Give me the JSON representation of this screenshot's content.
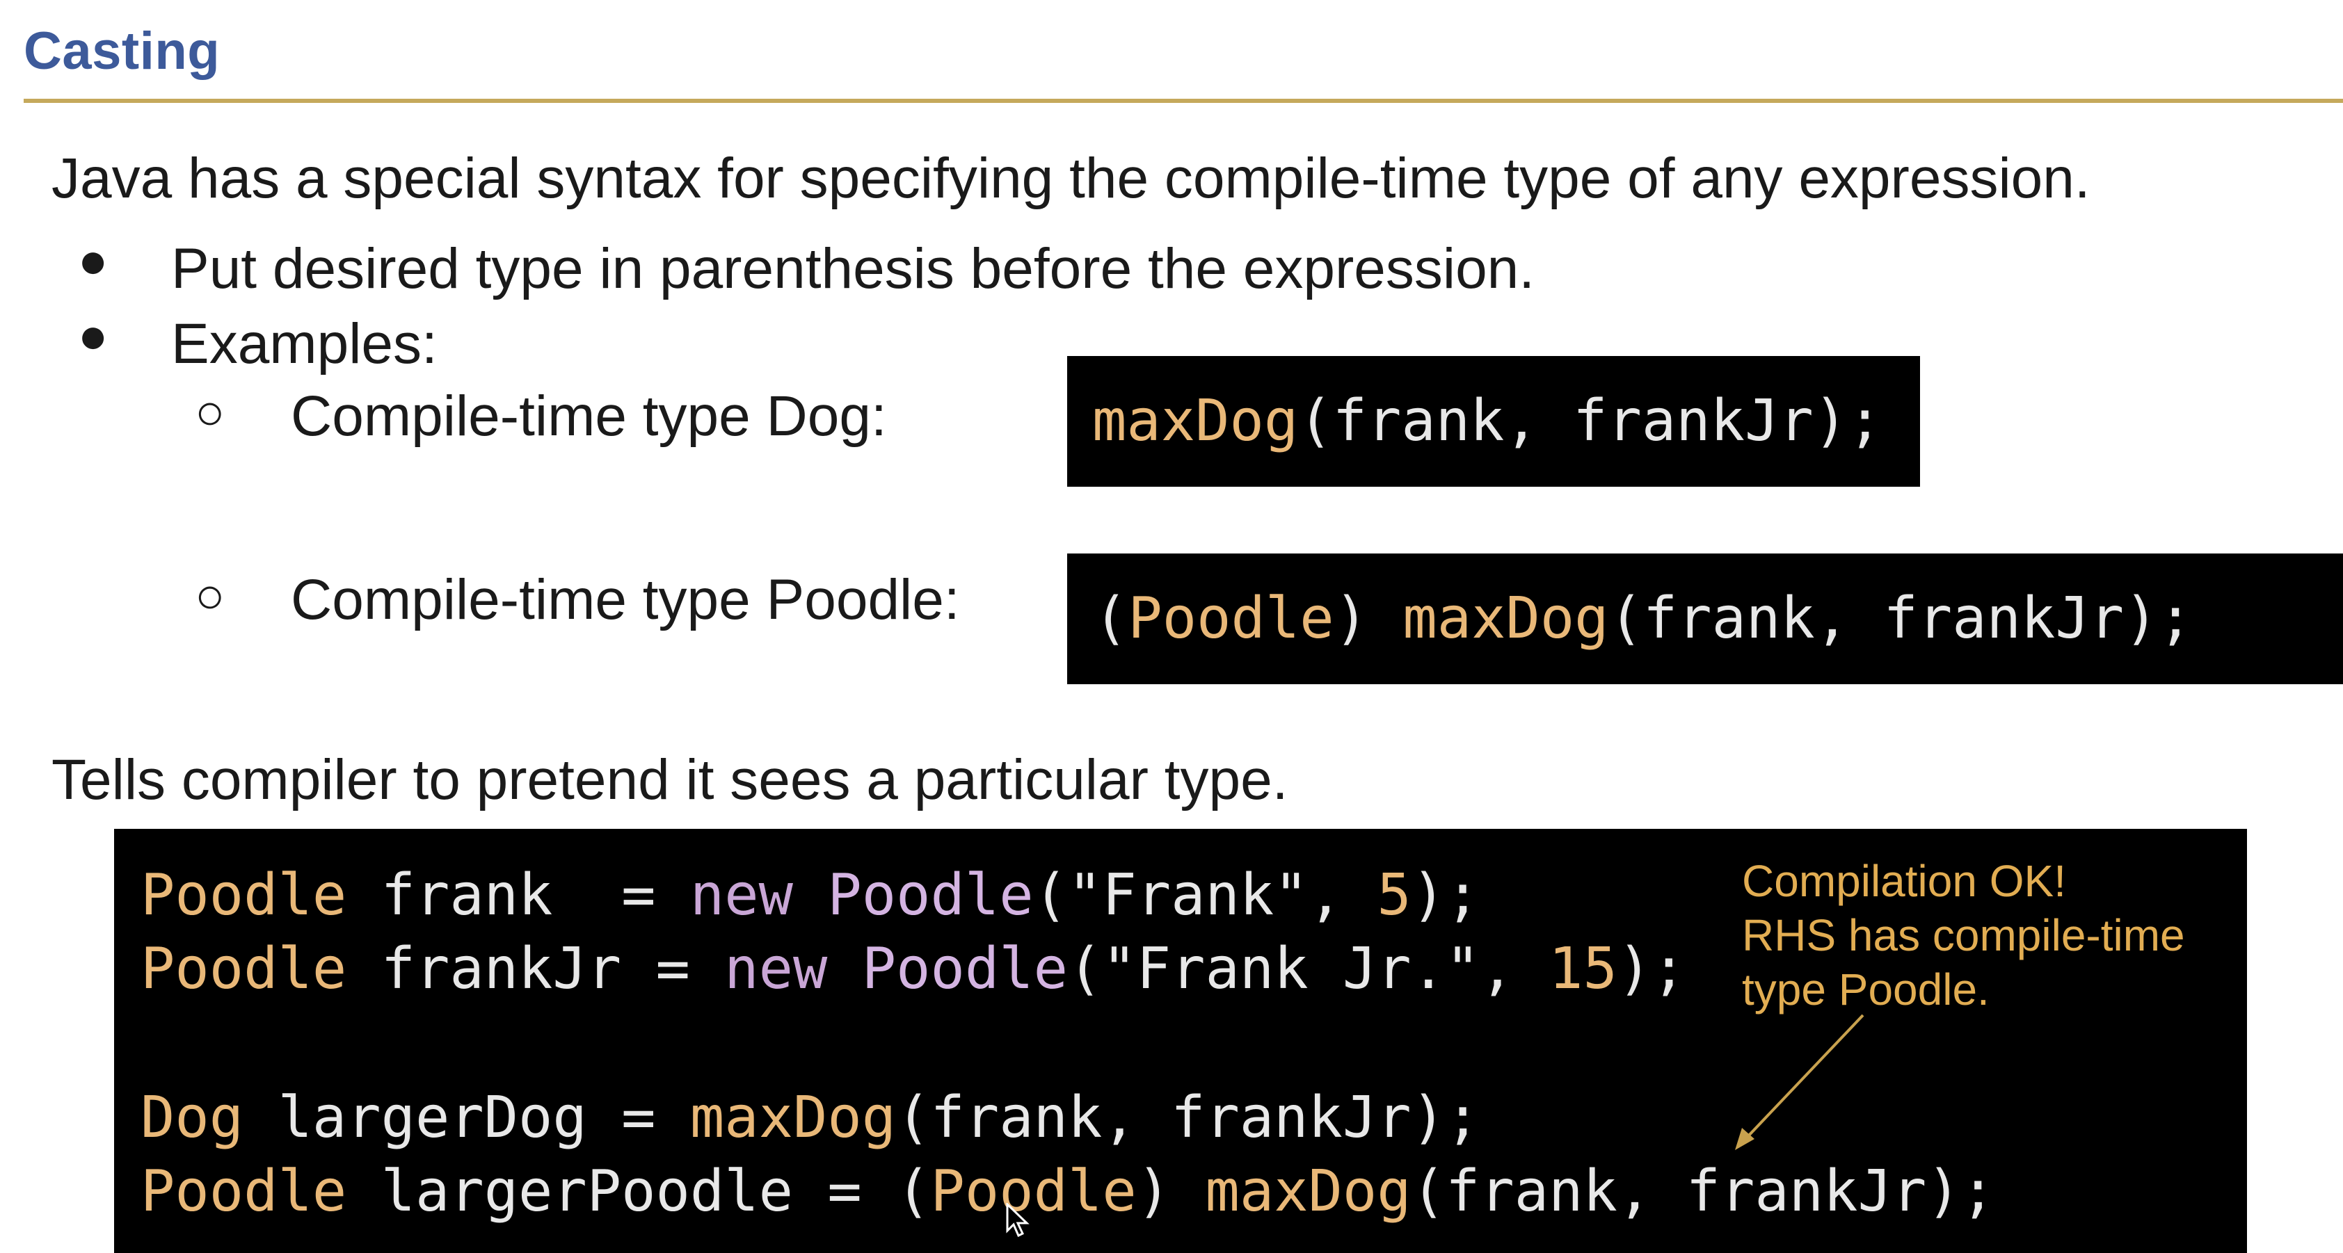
{
  "slide": {
    "title": "Casting",
    "intro": "Java has a special syntax for specifying the compile-time type of any expression.",
    "bullets": [
      "Put desired type in parenthesis before the expression.",
      "Examples:"
    ],
    "sub_bullets": [
      "Compile-time type Dog:",
      "Compile-time type Poodle:"
    ],
    "tells": "Tells compiler to pretend it sees a particular type."
  },
  "examples": {
    "dog": {
      "fn": "maxDog",
      "rest": "(frank, frankJr);"
    },
    "poodle": {
      "open": "(",
      "type": "Poodle",
      "close": ") ",
      "fn": "maxDog",
      "rest": "(frank, frankJr);"
    }
  },
  "code": {
    "line1": {
      "type": "Poodle",
      "var": " frank  = ",
      "new": "new",
      "sp": " ",
      "cls": "Poodle",
      "open": "(",
      "str": "\"Frank\"",
      "sep": ", ",
      "num": "5",
      "end": ");"
    },
    "line2": {
      "type": "Poodle",
      "var": " frankJr = ",
      "new": "new",
      "sp": " ",
      "cls": "Poodle",
      "open": "(",
      "str": "\"Frank Jr.\"",
      "sep": ", ",
      "num": "15",
      "end": ");"
    },
    "line3": {
      "type": "Dog",
      "var": " largerDog = ",
      "fn": "maxDog",
      "rest": "(frank, frankJr);"
    },
    "line4": {
      "type": "Poodle",
      "var": " largerPoodle = ",
      "open": "(",
      "cast": "Poodle",
      "close": ") ",
      "fn": "maxDog",
      "rest": "(frank, frankJr);"
    }
  },
  "annotation": {
    "lines": [
      "Compilation OK!",
      "RHS has compile-time",
      "type Poodle."
    ]
  },
  "colors": {
    "title": "#3d5a9a",
    "rule": "#c5a95c",
    "type_highlight": "#e9b878",
    "keyword_new": "#c9a6d6",
    "annotation": "#e2ad52",
    "code_bg": "#000000"
  }
}
